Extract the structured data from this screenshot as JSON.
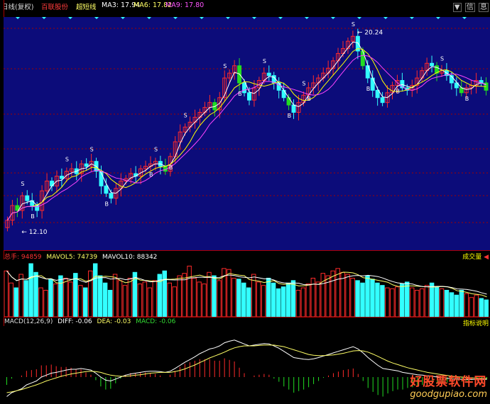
{
  "toolbar": {
    "period": "日线(复权)",
    "stock": "百联股份",
    "indicator": "超短线",
    "ma3": "MA3: 17.94",
    "ma6": "MA6: 17.82",
    "ma9": "MA9: 17.80",
    "icons": [
      "▼",
      "信",
      "息"
    ]
  },
  "main_chart": {
    "high_label": "20.24",
    "low_label": "12.10",
    "buy_marker": "B",
    "sell_marker": "S"
  },
  "volume_panel": {
    "total_label": "总手: 94859",
    "mavol5_label": "MAVOL5: 74739",
    "mavol10_label": "MAVOL10: 88342",
    "right_label": "成交量",
    "total_color": "#ff3333",
    "mavol5_color": "#ffff66",
    "mavol10_color": "#ffffff"
  },
  "macd_panel": {
    "name_label": "MACD(12,26,9)",
    "diff_label": "DIFF: -0.06",
    "dea_label": "DEA: -0.03",
    "macd_label": "MACD: -0.06",
    "right_label": "指标说明"
  },
  "watermark": {
    "title": "好股票软件网",
    "url": "goodgupiao.com"
  },
  "colors": {
    "background": "#0c0c7a",
    "up": "#ff2a2a",
    "down": "#33ffff",
    "green": "#22dd22",
    "grid": "#a00000",
    "ma3": "#ffffff",
    "ma6": "#ffff00",
    "ma9": "#ff44ff"
  },
  "chart_data": {
    "type": "candlestick",
    "y_high": 20.24,
    "y_low": 12.1,
    "close_path": [
      12.6,
      13.2,
      13.0,
      13.6,
      13.4,
      13.2,
      13.0,
      13.8,
      14.2,
      14.0,
      14.4,
      14.3,
      14.6,
      14.7,
      14.5,
      14.9,
      14.8,
      15.0,
      14.6,
      14.0,
      13.7,
      13.5,
      13.9,
      14.2,
      14.3,
      14.5,
      14.4,
      14.7,
      14.8,
      14.9,
      15.0,
      14.8,
      14.6,
      15.2,
      15.8,
      16.2,
      16.4,
      16.6,
      16.8,
      17.0,
      17.2,
      17.4,
      17.1,
      17.6,
      18.4,
      18.6,
      18.9,
      18.2,
      17.8,
      17.5,
      18.0,
      18.3,
      18.6,
      18.5,
      18.2,
      17.9,
      17.6,
      17.3,
      17.0,
      17.4,
      17.7,
      18.0,
      18.2,
      18.4,
      18.6,
      18.8,
      19.1,
      19.4,
      19.6,
      19.9,
      20.1,
      19.5,
      18.9,
      18.4,
      17.9,
      17.6,
      17.4,
      17.8,
      18.1,
      18.3,
      18.0,
      17.9,
      18.1,
      18.4,
      18.7,
      19.0,
      18.9,
      18.6,
      18.7,
      18.5,
      18.2,
      18.0,
      17.8,
      18.0,
      18.1,
      18.3,
      18.2,
      17.9
    ],
    "volume_values": [
      95,
      70,
      60,
      88,
      75,
      110,
      92,
      60,
      55,
      78,
      68,
      85,
      80,
      72,
      90,
      65,
      60,
      95,
      110,
      85,
      70,
      55,
      88,
      75,
      65,
      80,
      92,
      68,
      72,
      60,
      75,
      88,
      95,
      70,
      62,
      85,
      90,
      105,
      80,
      72,
      68,
      92,
      85,
      75,
      100,
      98,
      80,
      78,
      70,
      60,
      88,
      72,
      65,
      80,
      70,
      58,
      62,
      70,
      75,
      55,
      60,
      68,
      80,
      72,
      90,
      85,
      95,
      100,
      92,
      88,
      80,
      75,
      70,
      85,
      78,
      70,
      65,
      60,
      58,
      62,
      68,
      72,
      60,
      55,
      58,
      65,
      70,
      62,
      58,
      55,
      50,
      45,
      55,
      48,
      40,
      45,
      38,
      35
    ],
    "macd_diff": [
      -0.5,
      -0.4,
      -0.35,
      -0.3,
      -0.2,
      -0.15,
      -0.1,
      0.0,
      0.05,
      0.1,
      0.12,
      0.15,
      0.18,
      0.2,
      0.2,
      0.22,
      0.2,
      0.18,
      0.1,
      0.0,
      -0.08,
      -0.1,
      -0.05,
      0.0,
      0.05,
      0.08,
      0.1,
      0.12,
      0.14,
      0.15,
      0.15,
      0.14,
      0.12,
      0.15,
      0.22,
      0.3,
      0.38,
      0.45,
      0.52,
      0.6,
      0.66,
      0.72,
      0.75,
      0.8,
      0.88,
      0.92,
      0.95,
      0.9,
      0.85,
      0.8,
      0.82,
      0.84,
      0.86,
      0.85,
      0.8,
      0.74,
      0.66,
      0.58,
      0.5,
      0.48,
      0.46,
      0.45,
      0.47,
      0.5,
      0.54,
      0.58,
      0.62,
      0.66,
      0.7,
      0.74,
      0.78,
      0.72,
      0.62,
      0.5,
      0.4,
      0.3,
      0.22,
      0.2,
      0.18,
      0.16,
      0.12,
      0.1,
      0.08,
      0.06,
      0.05,
      0.03,
      0.02,
      0.0,
      -0.02,
      -0.03,
      -0.05,
      -0.05,
      -0.06,
      -0.06,
      -0.06,
      -0.06,
      -0.06,
      -0.06
    ],
    "macd_dea": [
      -0.4,
      -0.38,
      -0.35,
      -0.32,
      -0.28,
      -0.24,
      -0.2,
      -0.15,
      -0.1,
      -0.06,
      -0.02,
      0.02,
      0.05,
      0.08,
      0.1,
      0.12,
      0.14,
      0.15,
      0.14,
      0.12,
      0.08,
      0.05,
      0.03,
      0.02,
      0.02,
      0.03,
      0.05,
      0.06,
      0.08,
      0.1,
      0.11,
      0.12,
      0.12,
      0.12,
      0.14,
      0.17,
      0.21,
      0.26,
      0.31,
      0.37,
      0.43,
      0.49,
      0.54,
      0.59,
      0.64,
      0.7,
      0.75,
      0.78,
      0.8,
      0.8,
      0.8,
      0.81,
      0.82,
      0.82,
      0.82,
      0.8,
      0.78,
      0.74,
      0.7,
      0.66,
      0.62,
      0.58,
      0.56,
      0.55,
      0.55,
      0.56,
      0.57,
      0.59,
      0.61,
      0.64,
      0.67,
      0.68,
      0.67,
      0.64,
      0.59,
      0.53,
      0.47,
      0.41,
      0.36,
      0.32,
      0.28,
      0.24,
      0.21,
      0.18,
      0.15,
      0.12,
      0.1,
      0.08,
      0.06,
      0.04,
      0.02,
      0.01,
      0.0,
      -0.01,
      -0.02,
      -0.03,
      -0.03,
      -0.03
    ]
  }
}
